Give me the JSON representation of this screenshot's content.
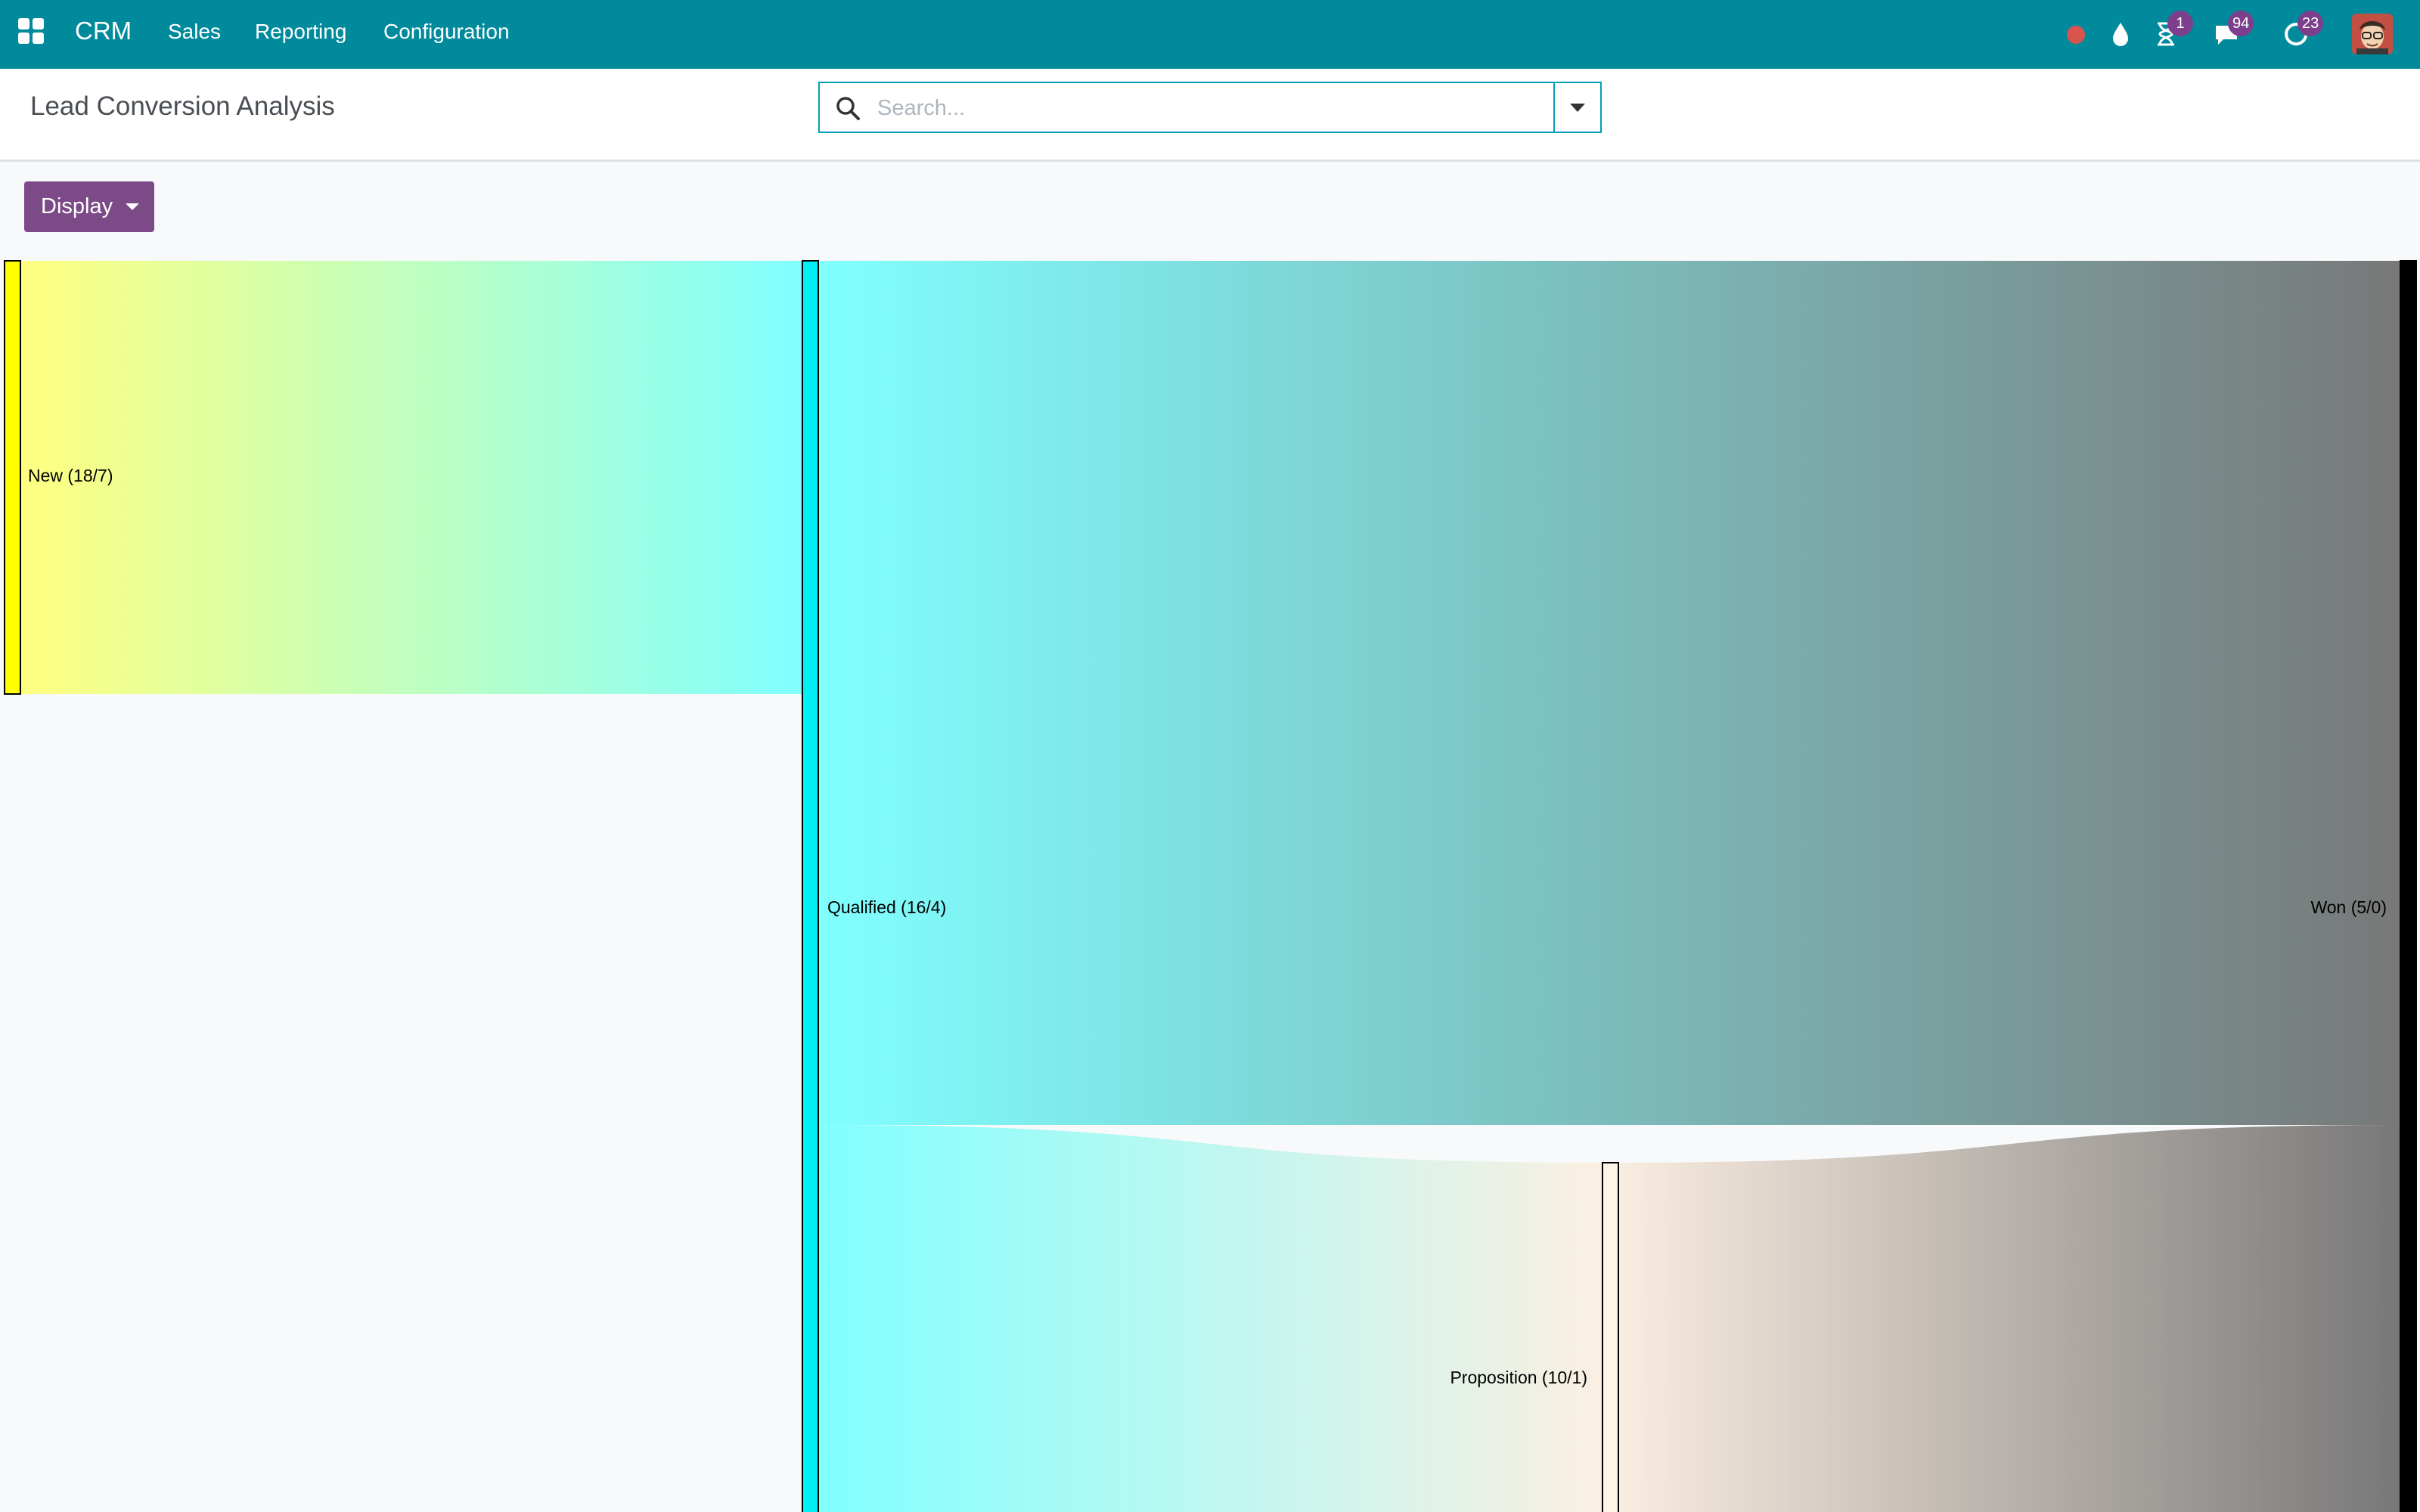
{
  "navbar": {
    "brand": "CRM",
    "menu": [
      "Sales",
      "Reporting",
      "Configuration"
    ],
    "icons": {
      "apps": "apps-grid-icon",
      "recording": "red-dot-icon",
      "drop": "drop-icon",
      "activities": "hourglass-icon",
      "messages": "chat-icon",
      "updates": "refresh-icon"
    },
    "badges": {
      "activities": "1",
      "messages": "94",
      "updates": "23"
    },
    "colors": {
      "navbar": "#008a9c",
      "badge": "#7c3f8c",
      "recording": "#d9534f"
    }
  },
  "control_panel": {
    "title": "Lead Conversion Analysis",
    "search": {
      "placeholder": "Search...",
      "value": ""
    },
    "display_button": "Display",
    "button_color": "#7c4a87"
  },
  "sankey": {
    "nodes": [
      {
        "id": "new",
        "label": "New (18/7)",
        "color": "#ffff00"
      },
      {
        "id": "qualified",
        "label": "Qualified (16/4)",
        "color": "#00ffff"
      },
      {
        "id": "proposition",
        "label": "Proposition (10/1)",
        "color": "#fff5e6"
      },
      {
        "id": "won",
        "label": "Won (5/0)",
        "color": "#000000"
      }
    ],
    "links": [
      {
        "source": "new",
        "target": "qualified"
      },
      {
        "source": "qualified",
        "target": "won"
      },
      {
        "source": "qualified",
        "target": "proposition"
      },
      {
        "source": "proposition",
        "target": "won"
      }
    ]
  }
}
